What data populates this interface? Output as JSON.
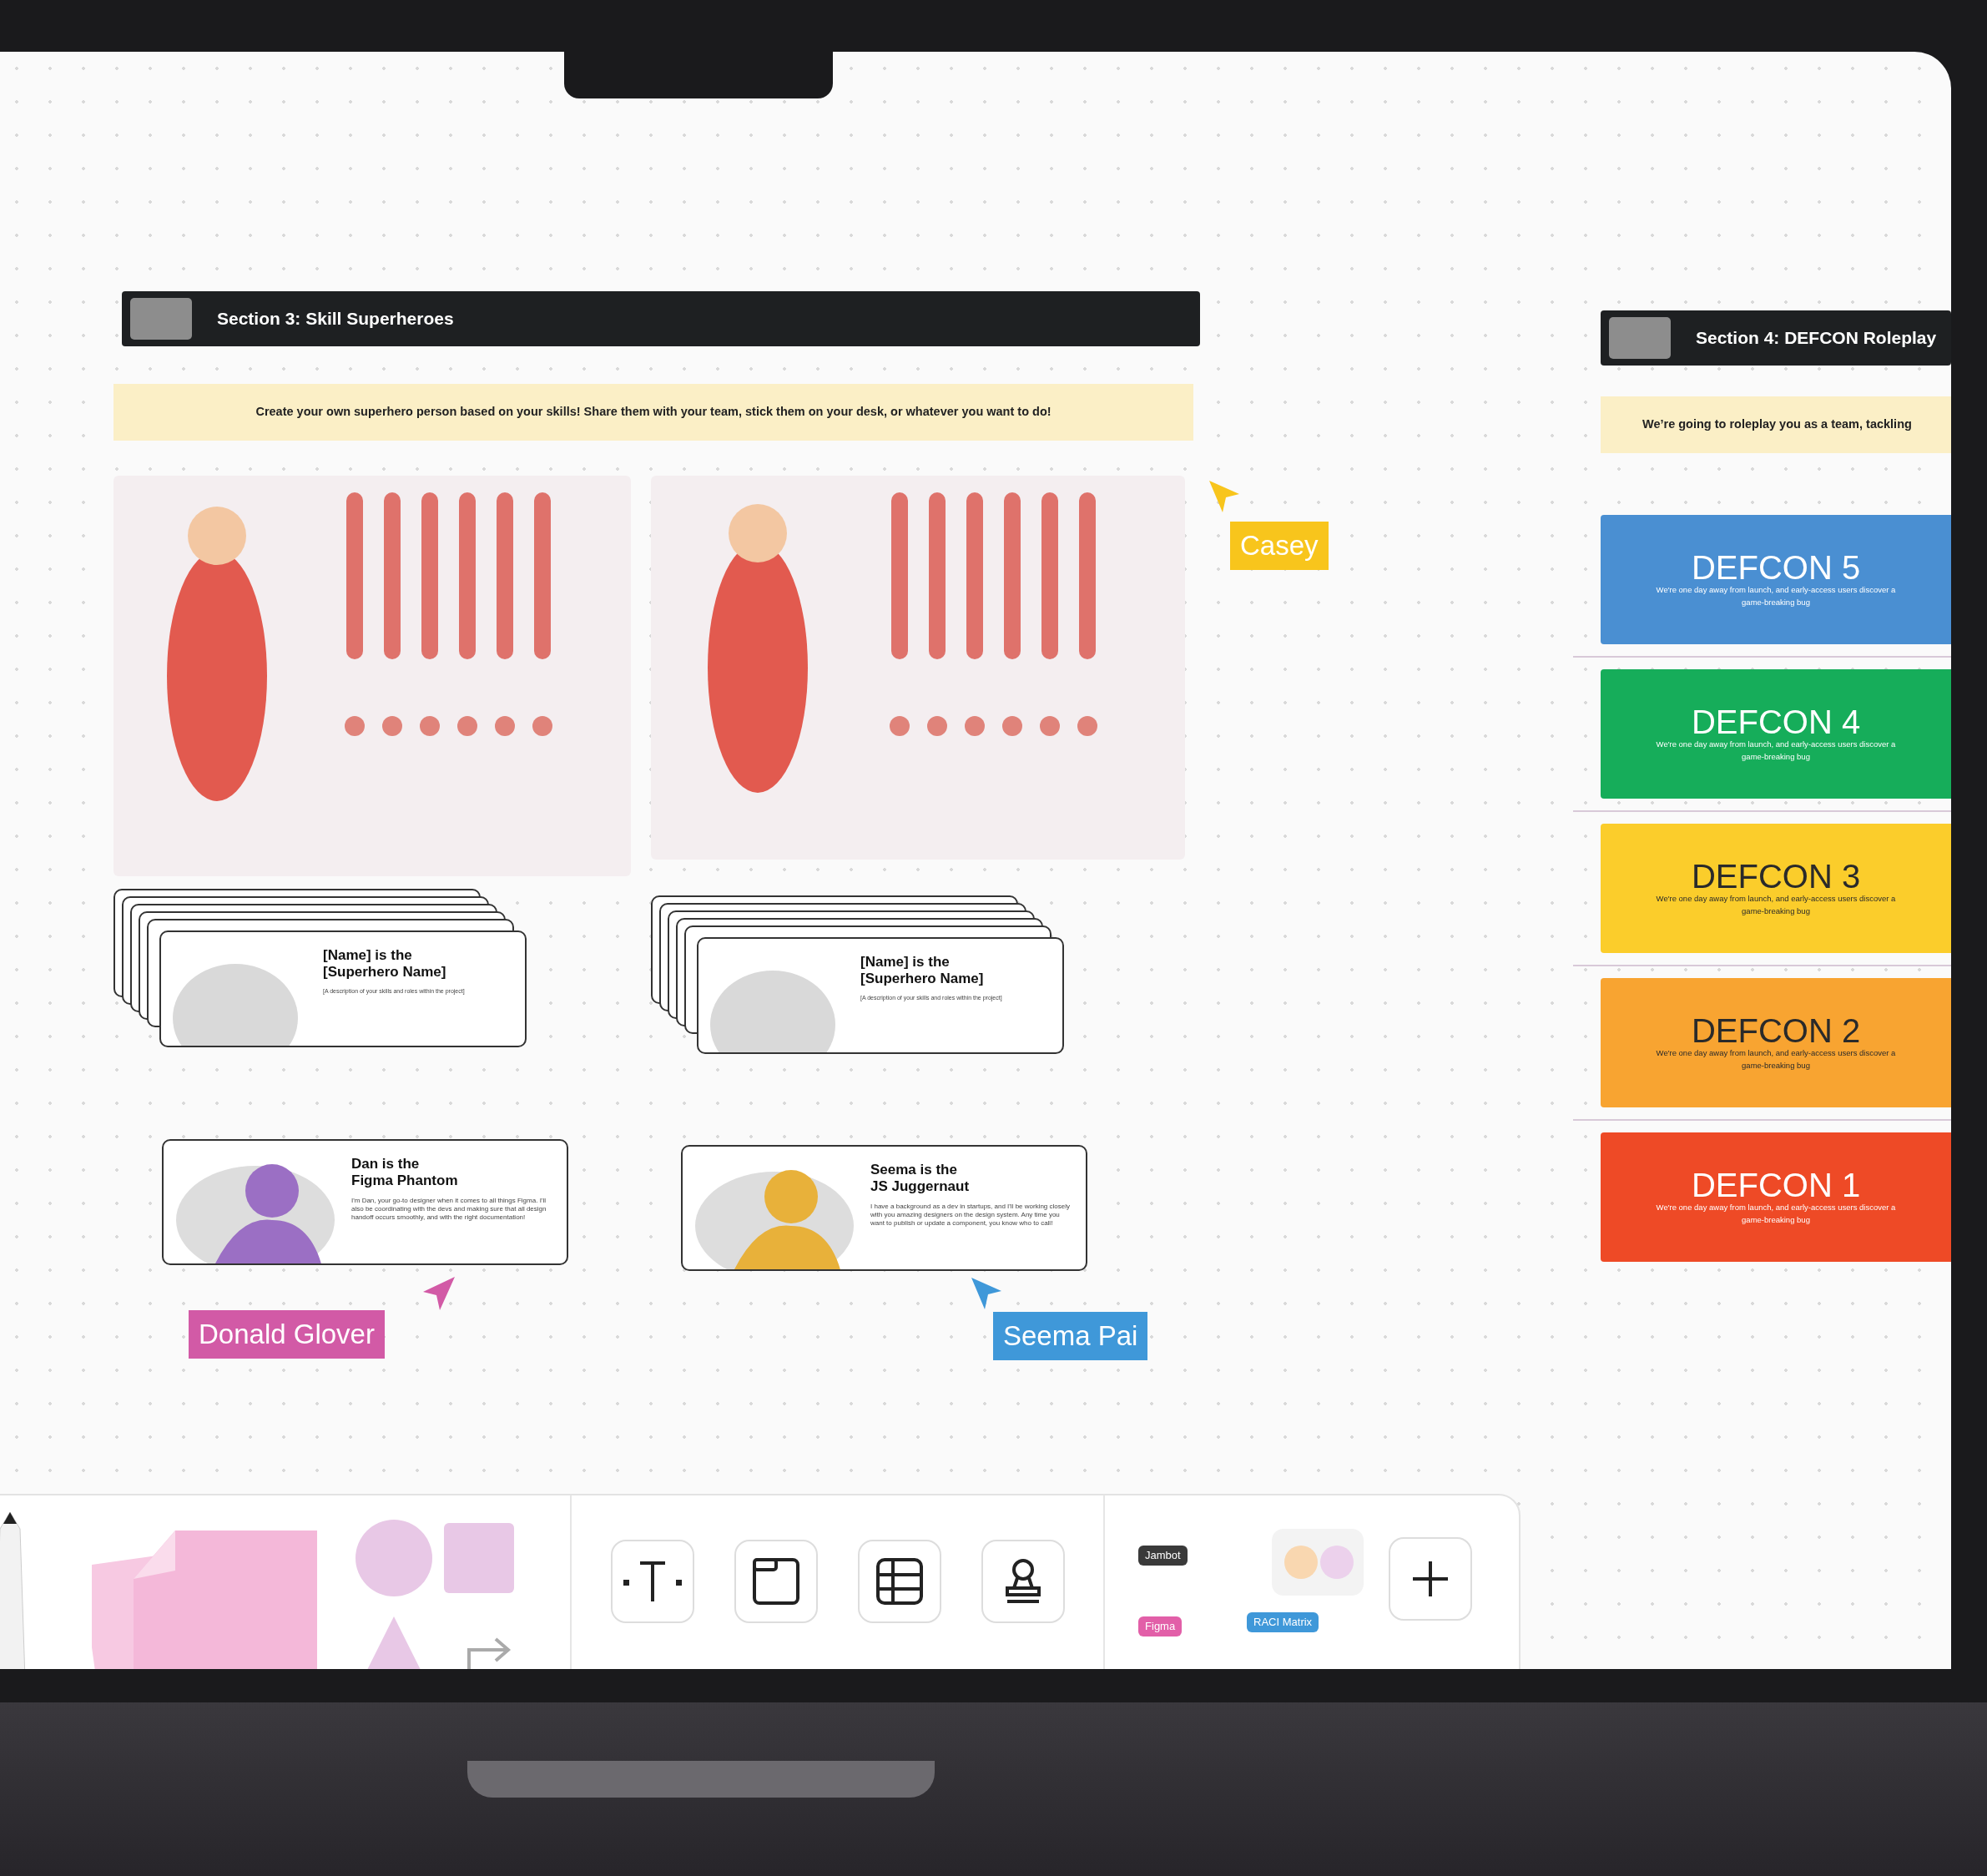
{
  "sections": [
    {
      "title": "Section 3: Skill Superheroes",
      "description": "Create your own superhero person based on your skills! Share them with your team, stick them on your desk, or whatever you want to do!"
    },
    {
      "title": "Section 4: DEFCON Roleplay",
      "description": "We’re going to roleplay you as a team, tackling"
    }
  ],
  "template_cards": [
    {
      "title": "[Name] is the\n[Superhero Name]",
      "description": "[A description of your skills and roles within the project]"
    },
    {
      "title": "[Name] is the\n[Superhero Name]",
      "description": "[A description of your skills and roles within the project]"
    }
  ],
  "hero_cards": [
    {
      "title": "Dan is the\nFigma Phantom",
      "description": "I'm Dan, your go-to designer when it comes to all things Figma. I'll also be coordinating with the devs and making sure that all design handoff occurs smoothly, and with the right documentation!"
    },
    {
      "title": "Seema is the\nJS Juggernaut",
      "description": "I have a background as a dev in startups, and I'll be working closely with you amazing designers on the design system. Any time you want to publish or update a component, you know who to call!"
    }
  ],
  "cursors": [
    {
      "name": "Casey",
      "color": "#f8c51c"
    },
    {
      "name": "Donald Glover",
      "color": "#d25aa6"
    },
    {
      "name": "Seema Pai",
      "color": "#3f98d9"
    }
  ],
  "defcon_levels": [
    {
      "title": "DEFCON 5",
      "description": "We're one day away from launch, and early-access users discover a game-breaking bug",
      "color": "#4a8fd2"
    },
    {
      "title": "DEFCON 4",
      "description": "We're one day away from launch, and early-access users discover a game-breaking bug",
      "color": "#16ad5a"
    },
    {
      "title": "DEFCON 3",
      "description": "We're one day away from launch, and early-access users discover a game-breaking bug",
      "color": "#fbcd2b"
    },
    {
      "title": "DEFCON 2",
      "description": "We're one day away from launch, and early-access users discover a game-breaking bug",
      "color": "#f8a431"
    },
    {
      "title": "DEFCON 1",
      "description": "We're one day away from launch, and early-access users discover a game-breaking bug",
      "color": "#ee4a26"
    }
  ],
  "stickers": [
    {
      "label": "Jambot"
    },
    {
      "label": "Figma"
    },
    {
      "label": "RACI Matrix"
    }
  ]
}
